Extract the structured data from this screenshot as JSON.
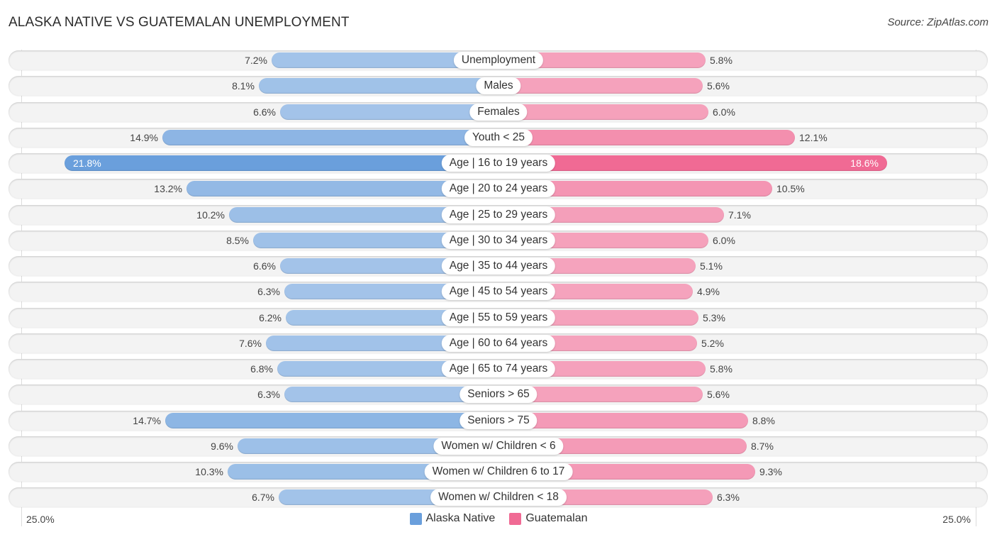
{
  "title": "ALASKA NATIVE VS GUATEMALAN UNEMPLOYMENT",
  "source": "Source: ZipAtlas.com",
  "colors": {
    "alaska_native": "#6a9fdc",
    "alaska_native_light": "#a7c6ea",
    "guatemalan": "#f06a94",
    "guatemalan_light": "#f5a6bf"
  },
  "axis": {
    "left_label": "25.0%",
    "right_label": "25.0%"
  },
  "legend": [
    {
      "label": "Alaska Native",
      "color": "#6a9fdc"
    },
    {
      "label": "Guatemalan",
      "color": "#f06a94"
    }
  ],
  "chart_data": {
    "type": "bar",
    "orientation": "horizontal-diverging",
    "title": "ALASKA NATIVE VS GUATEMALAN UNEMPLOYMENT",
    "xlabel": "",
    "ylabel": "",
    "xlim": [
      0,
      25
    ],
    "unit": "%",
    "legend_position": "bottom-center",
    "grid": false,
    "categories": [
      "Unemployment",
      "Males",
      "Females",
      "Youth < 25",
      "Age | 16 to 19 years",
      "Age | 20 to 24 years",
      "Age | 25 to 29 years",
      "Age | 30 to 34 years",
      "Age | 35 to 44 years",
      "Age | 45 to 54 years",
      "Age | 55 to 59 years",
      "Age | 60 to 64 years",
      "Age | 65 to 74 years",
      "Seniors > 65",
      "Seniors > 75",
      "Women w/ Children < 6",
      "Women w/ Children 6 to 17",
      "Women w/ Children < 18"
    ],
    "series": [
      {
        "name": "Alaska Native",
        "side": "left",
        "values": [
          7.2,
          8.1,
          6.6,
          14.9,
          21.8,
          13.2,
          10.2,
          8.5,
          6.6,
          6.3,
          6.2,
          7.6,
          6.8,
          6.3,
          14.7,
          9.6,
          10.3,
          6.7
        ],
        "labels": [
          "7.2%",
          "8.1%",
          "6.6%",
          "14.9%",
          "21.8%",
          "13.2%",
          "10.2%",
          "8.5%",
          "6.6%",
          "6.3%",
          "6.2%",
          "7.6%",
          "6.8%",
          "6.3%",
          "14.7%",
          "9.6%",
          "10.3%",
          "6.7%"
        ]
      },
      {
        "name": "Guatemalan",
        "side": "right",
        "values": [
          5.8,
          5.6,
          6.0,
          12.1,
          18.6,
          10.5,
          7.1,
          6.0,
          5.1,
          4.9,
          5.3,
          5.2,
          5.8,
          5.6,
          8.8,
          8.7,
          9.3,
          6.3
        ],
        "labels": [
          "5.8%",
          "5.6%",
          "6.0%",
          "12.1%",
          "18.6%",
          "10.5%",
          "7.1%",
          "6.0%",
          "5.1%",
          "4.9%",
          "5.3%",
          "5.2%",
          "5.8%",
          "5.6%",
          "8.8%",
          "8.7%",
          "9.3%",
          "6.3%"
        ]
      }
    ]
  }
}
